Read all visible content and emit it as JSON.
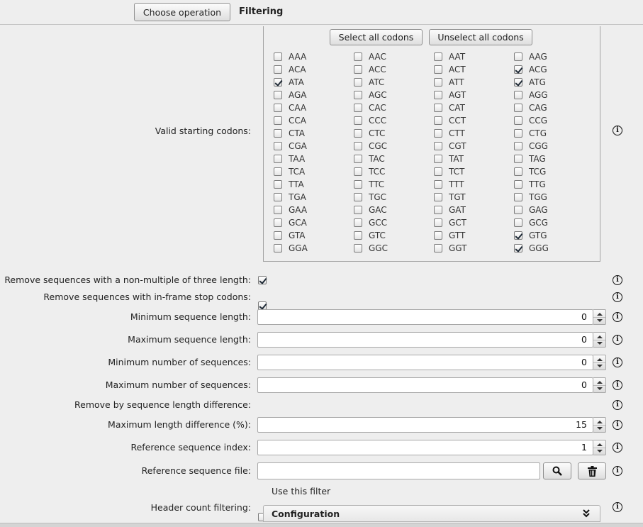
{
  "header": {
    "choose_operation_label": "Choose operation",
    "operation_name": "Filtering"
  },
  "codons": {
    "label": "Valid starting codons:",
    "select_all_label": "Select all codons",
    "unselect_all_label": "Unselect all codons",
    "grid": [
      [
        {
          "code": "AAA",
          "checked": false
        },
        {
          "code": "AAC",
          "checked": false
        },
        {
          "code": "AAT",
          "checked": false
        },
        {
          "code": "AAG",
          "checked": false
        }
      ],
      [
        {
          "code": "ACA",
          "checked": false
        },
        {
          "code": "ACC",
          "checked": false
        },
        {
          "code": "ACT",
          "checked": false
        },
        {
          "code": "ACG",
          "checked": true
        }
      ],
      [
        {
          "code": "ATA",
          "checked": true
        },
        {
          "code": "ATC",
          "checked": false
        },
        {
          "code": "ATT",
          "checked": false
        },
        {
          "code": "ATG",
          "checked": true
        }
      ],
      [
        {
          "code": "AGA",
          "checked": false
        },
        {
          "code": "AGC",
          "checked": false
        },
        {
          "code": "AGT",
          "checked": false
        },
        {
          "code": "AGG",
          "checked": false
        }
      ],
      [
        {
          "code": "CAA",
          "checked": false
        },
        {
          "code": "CAC",
          "checked": false
        },
        {
          "code": "CAT",
          "checked": false
        },
        {
          "code": "CAG",
          "checked": false
        }
      ],
      [
        {
          "code": "CCA",
          "checked": false
        },
        {
          "code": "CCC",
          "checked": false
        },
        {
          "code": "CCT",
          "checked": false
        },
        {
          "code": "CCG",
          "checked": false
        }
      ],
      [
        {
          "code": "CTA",
          "checked": false
        },
        {
          "code": "CTC",
          "checked": false
        },
        {
          "code": "CTT",
          "checked": false
        },
        {
          "code": "CTG",
          "checked": false
        }
      ],
      [
        {
          "code": "CGA",
          "checked": false
        },
        {
          "code": "CGC",
          "checked": false
        },
        {
          "code": "CGT",
          "checked": false
        },
        {
          "code": "CGG",
          "checked": false
        }
      ],
      [
        {
          "code": "TAA",
          "checked": false
        },
        {
          "code": "TAC",
          "checked": false
        },
        {
          "code": "TAT",
          "checked": false
        },
        {
          "code": "TAG",
          "checked": false
        }
      ],
      [
        {
          "code": "TCA",
          "checked": false
        },
        {
          "code": "TCC",
          "checked": false
        },
        {
          "code": "TCT",
          "checked": false
        },
        {
          "code": "TCG",
          "checked": false
        }
      ],
      [
        {
          "code": "TTA",
          "checked": false
        },
        {
          "code": "TTC",
          "checked": false
        },
        {
          "code": "TTT",
          "checked": false
        },
        {
          "code": "TTG",
          "checked": false
        }
      ],
      [
        {
          "code": "TGA",
          "checked": false
        },
        {
          "code": "TGC",
          "checked": false
        },
        {
          "code": "TGT",
          "checked": false
        },
        {
          "code": "TGG",
          "checked": false
        }
      ],
      [
        {
          "code": "GAA",
          "checked": false
        },
        {
          "code": "GAC",
          "checked": false
        },
        {
          "code": "GAT",
          "checked": false
        },
        {
          "code": "GAG",
          "checked": false
        }
      ],
      [
        {
          "code": "GCA",
          "checked": false
        },
        {
          "code": "GCC",
          "checked": false
        },
        {
          "code": "GCT",
          "checked": false
        },
        {
          "code": "GCG",
          "checked": false
        }
      ],
      [
        {
          "code": "GTA",
          "checked": false
        },
        {
          "code": "GTC",
          "checked": false
        },
        {
          "code": "GTT",
          "checked": false
        },
        {
          "code": "GTG",
          "checked": true
        }
      ],
      [
        {
          "code": "GGA",
          "checked": false
        },
        {
          "code": "GGC",
          "checked": false
        },
        {
          "code": "GGT",
          "checked": false
        },
        {
          "code": "GGG",
          "checked": true
        }
      ]
    ]
  },
  "options": {
    "non_multiple_three": {
      "label": "Remove sequences with a non-multiple of three length:",
      "checked": true
    },
    "inframe_stop": {
      "label": "Remove sequences with in-frame stop codons:",
      "checked": true
    },
    "min_seq_length": {
      "label": "Minimum sequence length:",
      "value": "0"
    },
    "max_seq_length": {
      "label": "Maximum sequence length:",
      "value": "0"
    },
    "min_num_seqs": {
      "label": "Minimum number of sequences:",
      "value": "0"
    },
    "max_num_seqs": {
      "label": "Maximum number of sequences:",
      "value": "0"
    },
    "remove_by_length_diff": {
      "label": "Remove by sequence length difference:",
      "checked": true
    },
    "max_length_diff": {
      "label": "Maximum length difference (%):",
      "value": "15"
    },
    "ref_seq_index": {
      "label": "Reference sequence index:",
      "value": "1"
    },
    "ref_seq_file": {
      "label": "Reference sequence file:",
      "value": ""
    },
    "header_count": {
      "label": "Header count filtering:",
      "use_filter_label": "Use this filter",
      "use_filter_checked": false,
      "config_label": "Configuration"
    }
  },
  "icons": {
    "info": "info-icon",
    "search": "search-icon",
    "trash": "trash-icon",
    "chevron": "chevron-double-down-icon"
  }
}
